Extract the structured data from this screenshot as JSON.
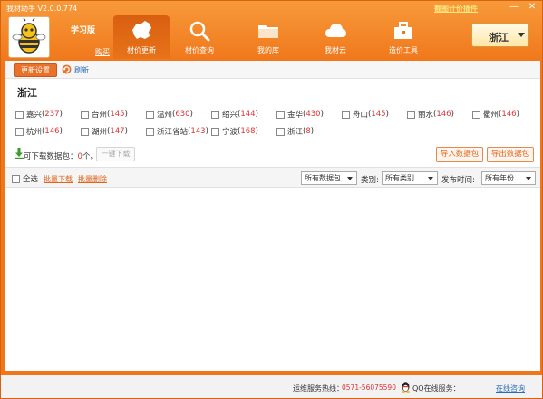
{
  "titlebar": {
    "app_title": "我材助手 V2.0.0.774",
    "plugin_link": "截图计价插件",
    "minimize": "—",
    "close": "✕"
  },
  "header": {
    "edition": "学习版",
    "buy_link": "购买",
    "nav": [
      {
        "label": "材价更新",
        "icon": "china-map-icon",
        "active": true
      },
      {
        "label": "材价查询",
        "icon": "search-icon",
        "active": false
      },
      {
        "label": "我的库",
        "icon": "folder-icon",
        "active": false
      },
      {
        "label": "我材云",
        "icon": "cloud-icon",
        "active": false
      },
      {
        "label": "造价工具",
        "icon": "toolbox-icon",
        "active": false
      }
    ],
    "province_button": "浙江"
  },
  "toolbar": {
    "update_settings": "更新设置",
    "refresh": "刷新"
  },
  "region": {
    "title": "浙江",
    "cities": [
      {
        "name": "嘉兴",
        "count": "237"
      },
      {
        "name": "台州",
        "count": "145"
      },
      {
        "name": "温州",
        "count": "630"
      },
      {
        "name": "绍兴",
        "count": "144"
      },
      {
        "name": "金华",
        "count": "430"
      },
      {
        "name": "舟山",
        "count": "145"
      },
      {
        "name": "丽水",
        "count": "146"
      },
      {
        "name": "衢州",
        "count": "146"
      },
      {
        "name": "杭州",
        "count": "146"
      },
      {
        "name": "湖州",
        "count": "147"
      },
      {
        "name": "浙江省站",
        "count": "143"
      },
      {
        "name": "宁波",
        "count": "168"
      },
      {
        "name": "浙江",
        "count": "8"
      }
    ]
  },
  "packages": {
    "label": "可下载数据包：",
    "count": "0",
    "unit": "个。",
    "one_click_download": "一键下载",
    "import": "导入数据包",
    "export": "导出数据包"
  },
  "list_bar": {
    "select_all": "全选",
    "bulk_download": "批量下载",
    "bulk_delete": "批量删除",
    "package_filter": "所有数据包",
    "category_label": "类别:",
    "category_filter": "所有类别",
    "date_label": "发布时间:",
    "date_filter": "所有年份"
  },
  "statusbar": {
    "hotline_label": "运维服务热线：",
    "hotline_number": "0571-56075590",
    "qq_label": "QQ在线服务：",
    "online_consult": "在线咨询"
  },
  "colors": {
    "brand_orange": "#f0761a",
    "accent_red": "#d33333",
    "link_blue": "#2a6bb8"
  }
}
